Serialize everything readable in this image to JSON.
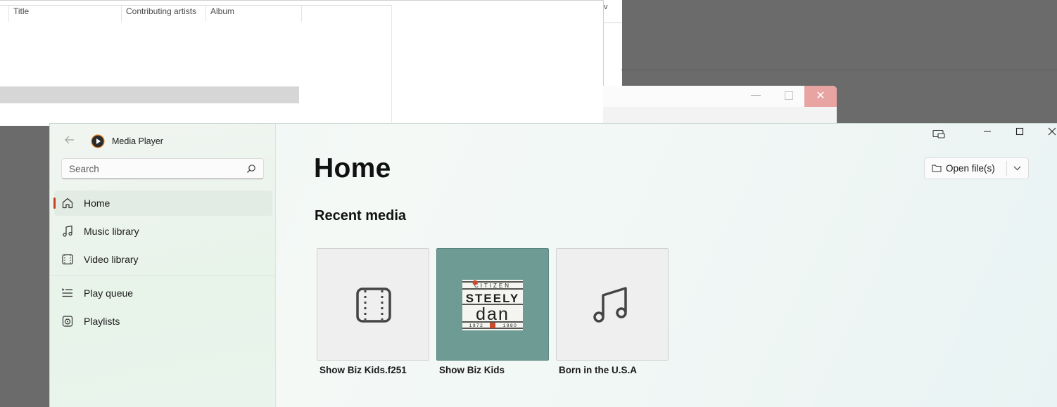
{
  "background_explorer": {
    "columns": [
      "Title",
      "Contributing artists",
      "Album"
    ],
    "edge_glyph": "v"
  },
  "media_player": {
    "app_title": "Media Player",
    "search": {
      "placeholder": "Search"
    },
    "nav": [
      {
        "label": "Home",
        "icon": "home-icon",
        "active": true
      },
      {
        "label": "Music library",
        "icon": "music-note-icon",
        "active": false
      },
      {
        "label": "Video library",
        "icon": "film-icon",
        "active": false
      },
      {
        "label": "Play queue",
        "icon": "queue-list-icon",
        "active": false
      },
      {
        "label": "Playlists",
        "icon": "playlist-icon",
        "active": false
      }
    ],
    "page_title": "Home",
    "section_title": "Recent media",
    "open_button": {
      "label": "Open file(s)",
      "icon": "folder-icon"
    },
    "recent": [
      {
        "title": "Show Biz Kids.f251",
        "thumb": "video-placeholder-icon"
      },
      {
        "title": "Show Biz Kids",
        "thumb": "album-art",
        "art_text": [
          "CITIZEN",
          "STEELY",
          "dan",
          "1972",
          "1980"
        ]
      },
      {
        "title": "Born in the U.S.A",
        "thumb": "music-placeholder-icon"
      }
    ],
    "accent_color": "#c4421e",
    "album_art_color": "#6e9c95"
  }
}
